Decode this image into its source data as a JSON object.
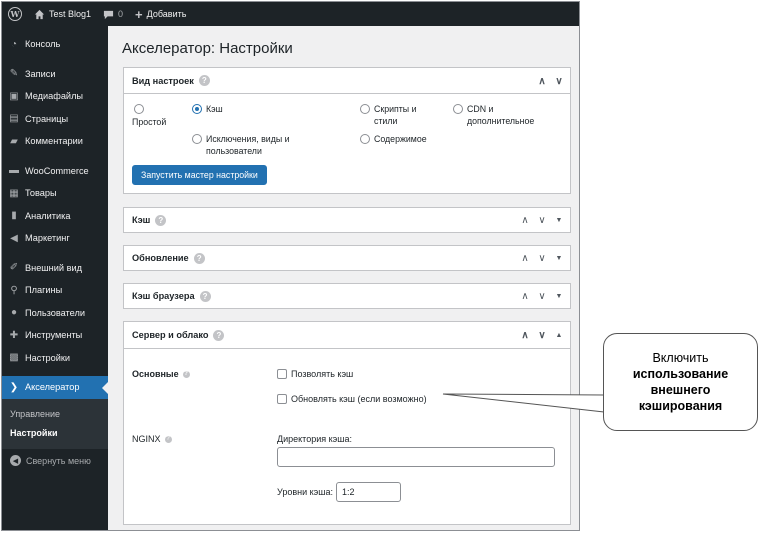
{
  "adminbar": {
    "site_name": "Test Blog1",
    "comments_count": "0",
    "add_new": "Добавить"
  },
  "sidebar": {
    "items": [
      {
        "label": "Консоль",
        "icon": "dashboard-icon"
      },
      {
        "label": "Записи",
        "icon": "pin-icon"
      },
      {
        "label": "Медиафайлы",
        "icon": "media-icon"
      },
      {
        "label": "Страницы",
        "icon": "pages-icon"
      },
      {
        "label": "Комментарии",
        "icon": "comments-icon"
      },
      {
        "label": "WooCommerce",
        "icon": "woocommerce-icon"
      },
      {
        "label": "Товары",
        "icon": "products-icon"
      },
      {
        "label": "Аналитика",
        "icon": "analytics-icon"
      },
      {
        "label": "Маркетинг",
        "icon": "marketing-icon"
      },
      {
        "label": "Внешний вид",
        "icon": "appearance-icon"
      },
      {
        "label": "Плагины",
        "icon": "plugins-icon"
      },
      {
        "label": "Пользователи",
        "icon": "users-icon"
      },
      {
        "label": "Инструменты",
        "icon": "tools-icon"
      },
      {
        "label": "Настройки",
        "icon": "settings-icon"
      },
      {
        "label": "Акселератор",
        "icon": "accelerator-icon"
      }
    ],
    "submenu": [
      "Управление",
      "Настройки"
    ],
    "collapse": "Свернуть меню"
  },
  "page": {
    "title": "Акселератор: Настройки"
  },
  "view_box": {
    "title": "Вид настроек",
    "options": {
      "simple": "Простой",
      "cache": "Кэш",
      "scripts": "Скрипты и стили",
      "cdn": "CDN и дополнительное",
      "exclusions": "Исключения, виды и пользователи",
      "content": "Содержимое"
    },
    "selected": "Кэш",
    "wizard_button": "Запустить мастер настройки"
  },
  "collapsed_boxes": [
    "Кэш",
    "Обновление",
    "Кэш браузера"
  ],
  "server_box": {
    "title": "Сервер и облако",
    "basic_label": "Основные",
    "allow_cache": "Позволять кэш",
    "update_cache": "Обновлять кэш (если возможно)",
    "nginx_label": "NGINX",
    "cache_dir_label": "Директория кэша:",
    "cache_dir_value": "",
    "cache_levels_label": "Уровни кэша:",
    "cache_levels_value": "1:2"
  },
  "callout": {
    "line1": "Включить",
    "line2": "использование",
    "line3": "внешнего",
    "line4": "кэширования"
  },
  "colors": {
    "accent": "#2271b1",
    "sidebar": "#1d2327",
    "background": "#f0f0f1"
  }
}
